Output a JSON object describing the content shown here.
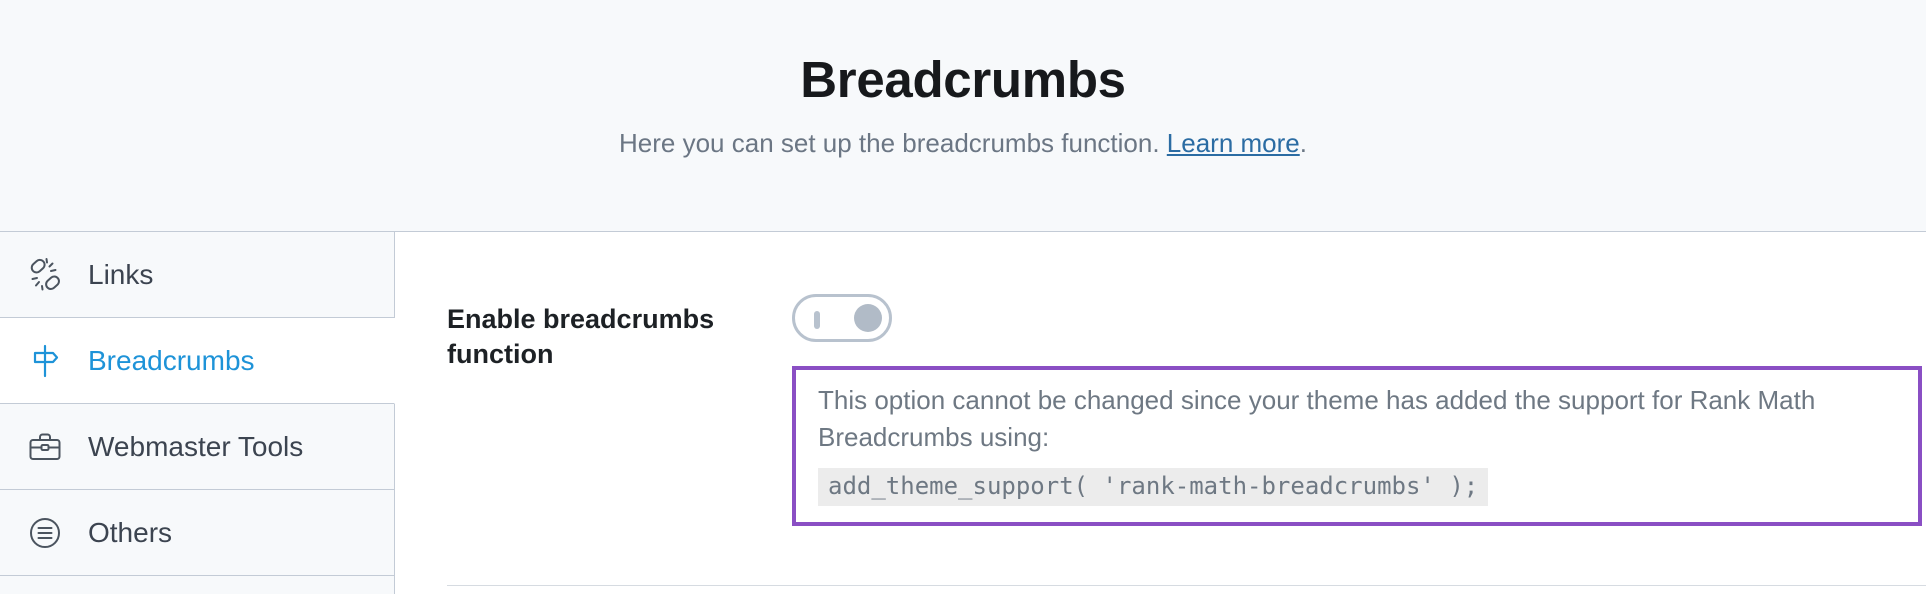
{
  "header": {
    "title": "Breadcrumbs",
    "subtitle_before": "Here you can set up the breadcrumbs function. ",
    "subtitle_link": "Learn more",
    "subtitle_after": ".",
    "background_color": "#f7f9fb",
    "link_color": "#2b6ca3"
  },
  "sidebar": {
    "items": [
      {
        "label": "Links",
        "icon": "broken-link-icon",
        "active": false
      },
      {
        "label": "Breadcrumbs",
        "icon": "signpost-icon",
        "active": true
      },
      {
        "label": "Webmaster Tools",
        "icon": "briefcase-icon",
        "active": false
      },
      {
        "label": "Others",
        "icon": "circle-list-icon",
        "active": false
      }
    ],
    "active_color": "#1e93d8"
  },
  "main": {
    "setting": {
      "label": "Enable breadcrumbs function",
      "toggle_state": "on",
      "toggle_disabled": true
    },
    "notice": {
      "text": "This option cannot be changed since your theme has added the support for Rank Math Breadcrumbs using:",
      "code": "add_theme_support( 'rank-math-breadcrumbs' );",
      "border_color": "#8a4fc4"
    }
  }
}
